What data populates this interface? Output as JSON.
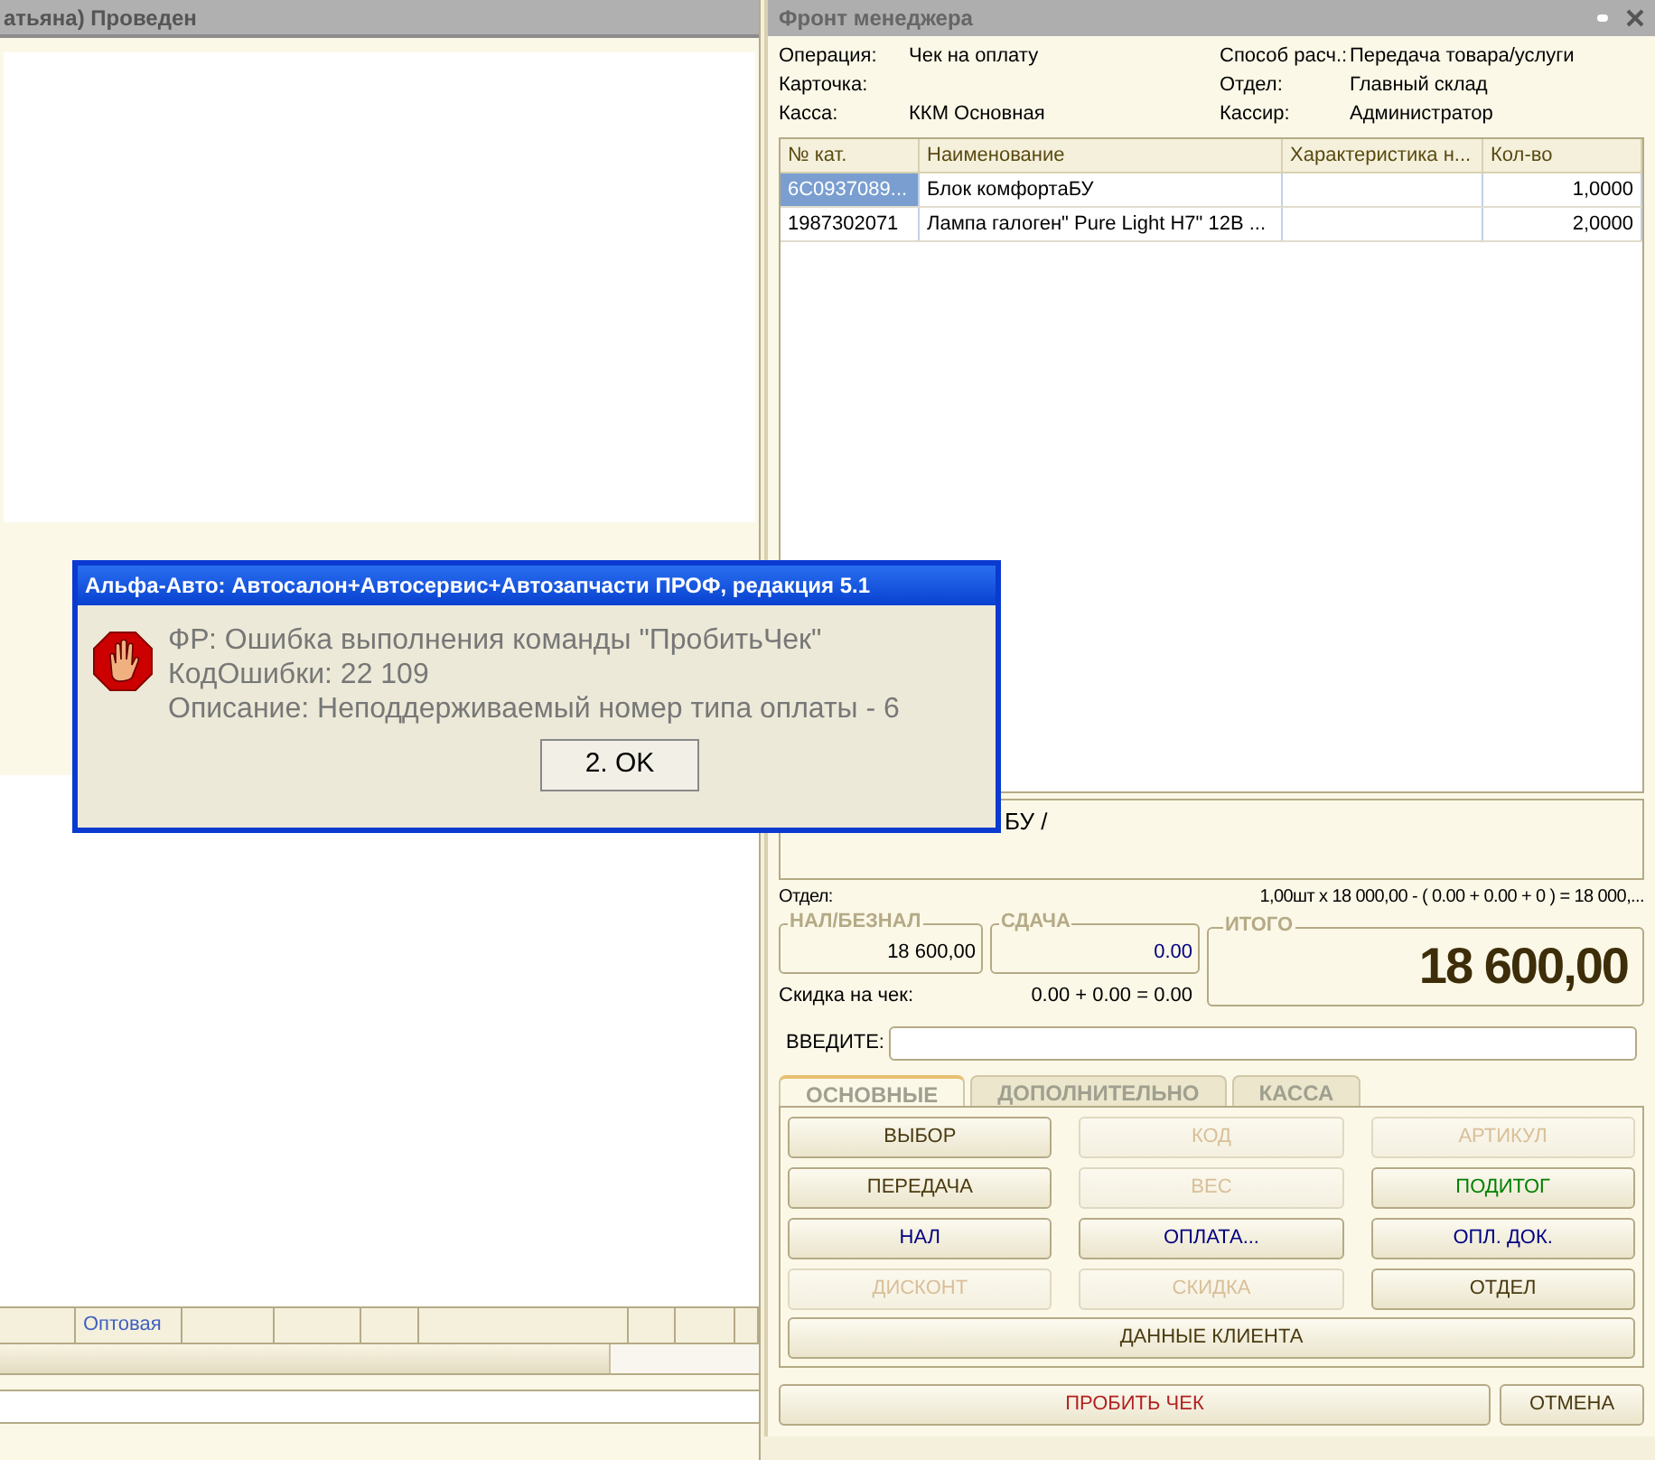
{
  "back_window": {
    "title": "атьяна) Проведен",
    "table_row": [
      {
        "text": "Оптовая"
      }
    ]
  },
  "front_window": {
    "title": "Фронт менеджера",
    "info_left": [
      {
        "label": "Операция:",
        "value": "Чек на оплату"
      },
      {
        "label": "Карточка:"
      },
      {
        "label": "Касса:",
        "value": "ККМ Основная"
      }
    ],
    "info_right": [
      {
        "label": "Способ расч.:",
        "value": "Передача товара/услуги"
      },
      {
        "label": "Отдел:",
        "value": "Главный склад"
      },
      {
        "label": "Кассир:",
        "value": "Администратор"
      }
    ],
    "table": {
      "columns": [
        "№ кат.",
        "Наименование",
        "Характеристика н...",
        "Кол-во"
      ],
      "rows": [
        {
          "selected": true,
          "cells": [
            "6C0937089...",
            "Блок комфортаБУ",
            "",
            "1,0000"
          ]
        },
        {
          "selected": false,
          "cells": [
            "1987302071",
            "Лампа галоген\" Pure Light H7\" 12В ...",
            "",
            "2,0000"
          ]
        }
      ]
    },
    "info_box": "БУ /",
    "department_label": "Отдел:",
    "calc_line": "1,00шт x 18 000,00 - ( 0.00 + 0.00 + 0 ) = 18 000,...",
    "cash": {
      "label": "НАЛ/БЕЗНАЛ",
      "value": "18 600,00"
    },
    "change": {
      "label": "СДАЧА",
      "value": "0.00"
    },
    "total": {
      "label": "ИТОГО",
      "value": "18 600,00"
    },
    "discount": {
      "label": "Скидка на чек:",
      "value": "0.00 + 0.00 = 0.00"
    },
    "input": {
      "label": "ВВЕДИТЕ:"
    },
    "tabs": [
      {
        "label": "ОСНОВНЫЕ",
        "selected": true
      },
      {
        "label": "ДОПОЛНИТЕЛЬНО",
        "selected": false
      },
      {
        "label": "КАССА",
        "selected": false
      }
    ],
    "buttons": [
      {
        "label": "ВЫБОР",
        "disabled": false,
        "color": "#4a3a10"
      },
      {
        "label": "КОД",
        "disabled": true,
        "color": "#d9bf98"
      },
      {
        "label": "АРТИКУЛ",
        "disabled": true,
        "color": "#d9bf98"
      },
      {
        "label": "ПЕРЕДАЧА",
        "disabled": false,
        "color": "#4a3a10"
      },
      {
        "label": "ВЕС",
        "disabled": true,
        "color": "#d9bf98"
      },
      {
        "label": "ПОДИТОГ",
        "disabled": false,
        "color": "#008000"
      },
      {
        "label": "НАЛ",
        "disabled": false,
        "color": "#000080"
      },
      {
        "label": "ОПЛАТА...",
        "disabled": false,
        "color": "#000080"
      },
      {
        "label": "ОПЛ. ДОК.",
        "disabled": false,
        "color": "#000080"
      },
      {
        "label": "ДИСКОНТ",
        "disabled": true,
        "color": "#d9bf98"
      },
      {
        "label": "СКИДКА",
        "disabled": true,
        "color": "#d9bf98"
      },
      {
        "label": "ОТДЕЛ",
        "disabled": false,
        "color": "#4a3a10"
      }
    ],
    "client_button": "ДАННЫЕ КЛИЕНТА",
    "bottom_buttons": [
      {
        "label": "ПРОБИТЬ ЧЕК",
        "color": "#b22222"
      },
      {
        "label": "ОТМЕНА",
        "color": "#4a3a10"
      }
    ]
  },
  "dialog": {
    "title": "Альфа-Авто: Автосалон+Автосервис+Автозапчасти ПРОФ, редакция 5.1",
    "lines": [
      "ФР: Ошибка выполнения команды \"ПробитьЧек\"",
      "КодОшибки: 22 109",
      "Описание: Неподдерживаемый номер типа оплаты - 6"
    ],
    "button": "2. OK"
  }
}
